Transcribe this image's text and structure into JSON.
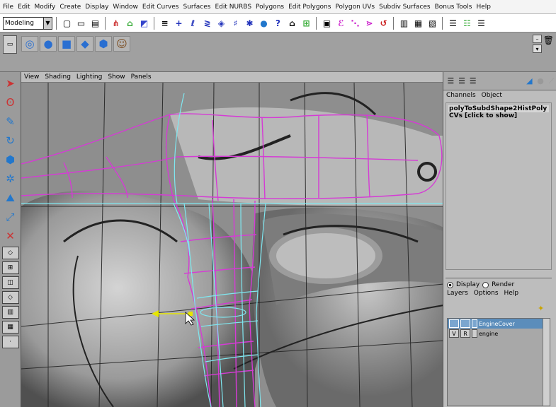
{
  "menu": [
    "File",
    "Edit",
    "Modify",
    "Create",
    "Display",
    "Window",
    "Edit Curves",
    "Surfaces",
    "Edit NURBS",
    "Polygons",
    "Edit Polygons",
    "Polygon UVs",
    "Subdiv Surfaces",
    "Bonus Tools",
    "Help"
  ],
  "status": {
    "mode": "Modeling"
  },
  "viewport": {
    "menu": [
      "View",
      "Shading",
      "Lighting",
      "Show",
      "Panels"
    ]
  },
  "channels": {
    "tabs": [
      "Channels",
      "Object"
    ],
    "object_name": "polyToSubdShape2HistPoly",
    "cvs_label": "CVs [click to show]"
  },
  "layers": {
    "display_label": "Display",
    "render_label": "Render",
    "menu": [
      "Layers",
      "Options",
      "Help"
    ],
    "rows": [
      {
        "name": "EngineCover",
        "col1": "",
        "col2": ""
      },
      {
        "name": "engine",
        "col1": "V",
        "col2": "R"
      }
    ]
  },
  "colors": {
    "wire_magenta": "#d53bd5",
    "wire_cyan": "#7fe7f0",
    "layer_selected": "#5b8dbb"
  }
}
